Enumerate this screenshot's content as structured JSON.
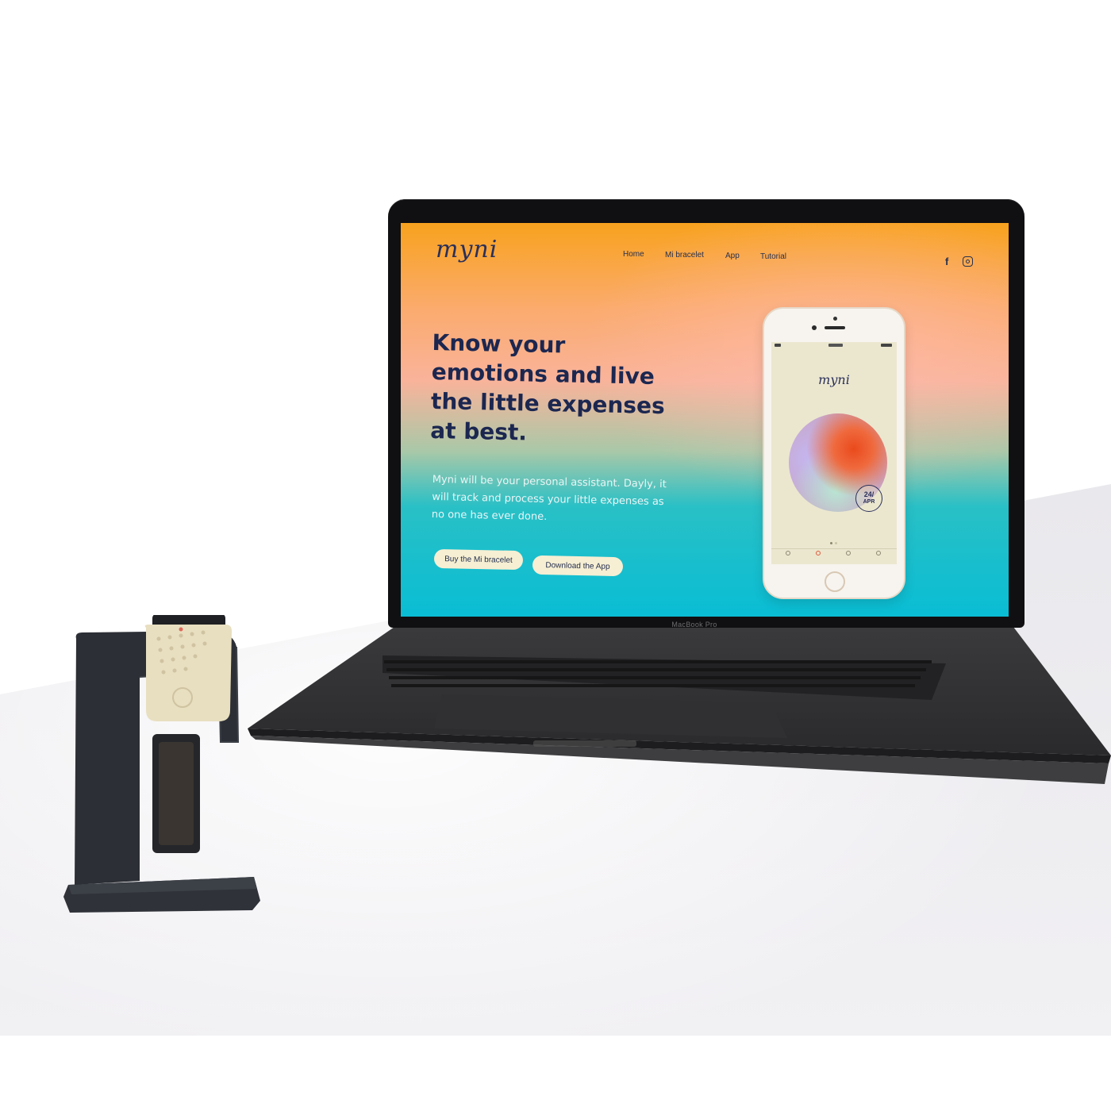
{
  "site": {
    "logo": "myni",
    "nav": [
      {
        "label": "Home"
      },
      {
        "label": "Mi bracelet"
      },
      {
        "label": "App"
      },
      {
        "label": "Tutorial"
      }
    ],
    "social": {
      "facebook": "f"
    },
    "hero": {
      "title": "Know your emotions and live the  little expenses at best.",
      "body": "Myni will be your personal assistant. Dayly, it will track and process your little expenses as no one has ever done."
    },
    "buttons": {
      "buy": "Buy the Mi bracelet",
      "download": "Download the App"
    }
  },
  "phone": {
    "app_logo": "myni",
    "date_day": "24/",
    "date_month": "APR"
  },
  "device": {
    "model": "MacBook Pro"
  },
  "colors": {
    "heading": "#1c2750",
    "button_bg": "#f6efd3",
    "gradient_top": "#f8a21e",
    "gradient_bottom": "#09bdd4"
  },
  "icons": [
    "facebook-icon",
    "instagram-icon"
  ]
}
